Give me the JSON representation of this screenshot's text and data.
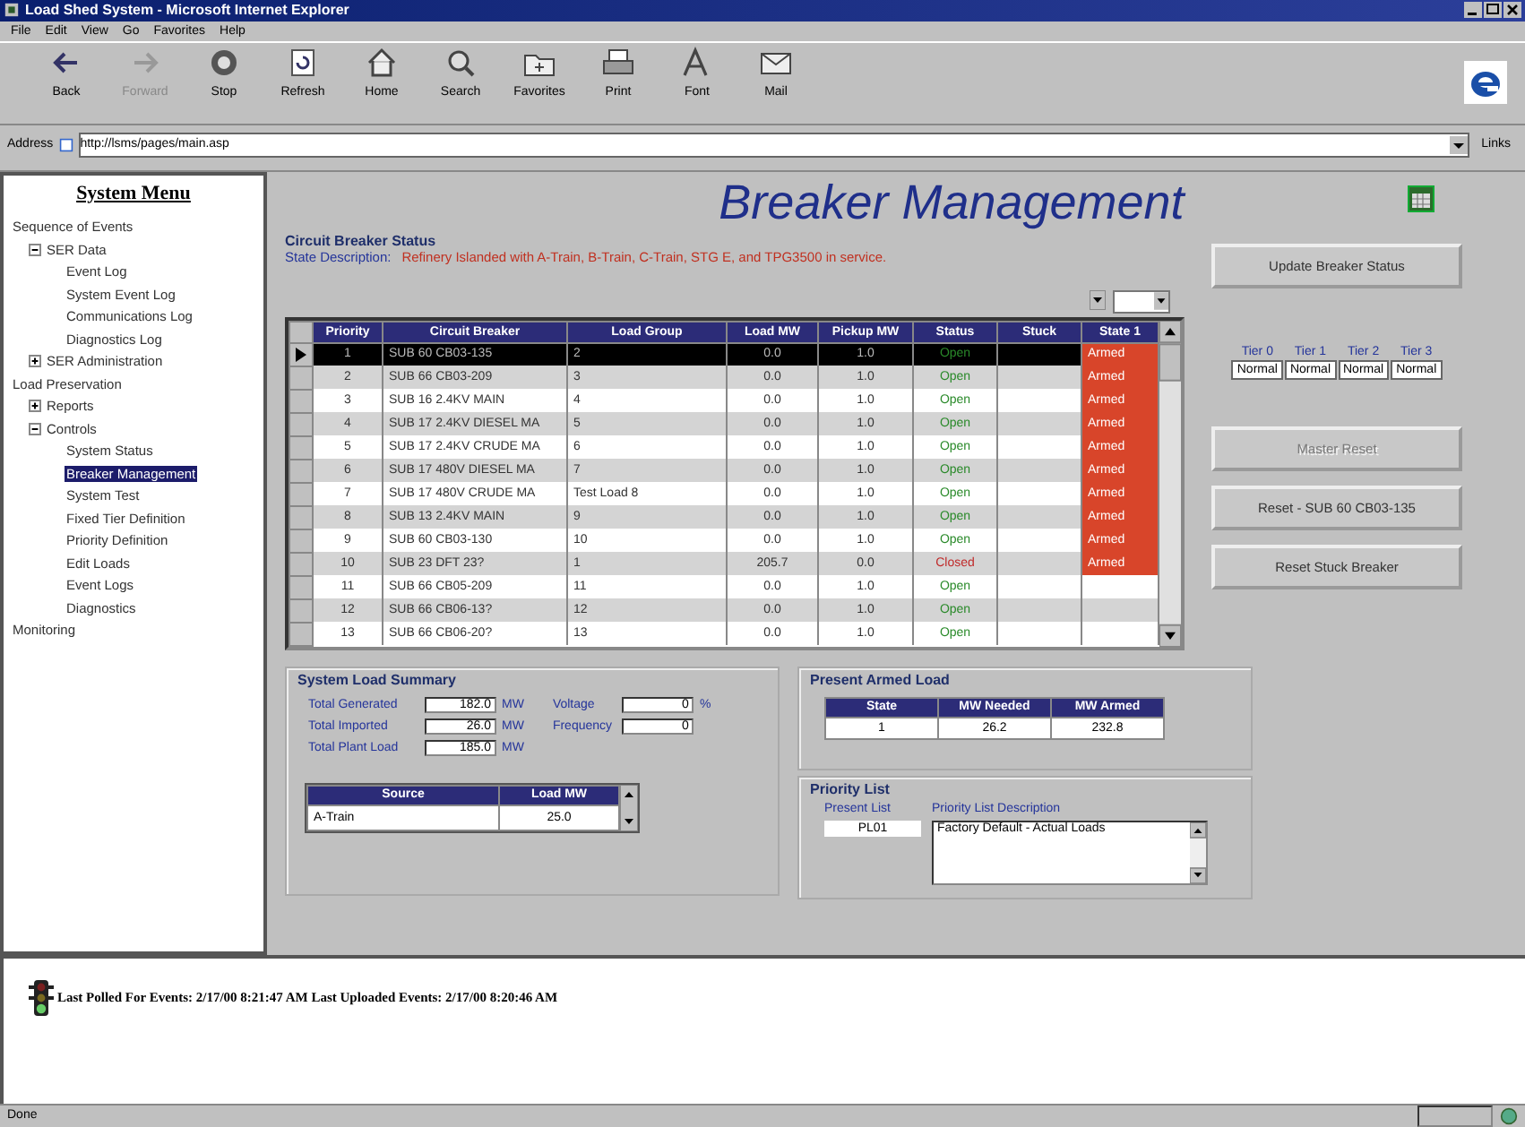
{
  "window": {
    "title": "Load Shed System - Microsoft Internet Explorer"
  },
  "menu": [
    "File",
    "Edit",
    "View",
    "Go",
    "Favorites",
    "Help"
  ],
  "toolbar": [
    {
      "label": "Back",
      "disabled": false
    },
    {
      "label": "Forward",
      "disabled": true
    },
    {
      "label": "Stop",
      "disabled": false
    },
    {
      "label": "Refresh",
      "disabled": false
    },
    {
      "label": "Home",
      "disabled": false
    },
    {
      "label": "Search",
      "disabled": false
    },
    {
      "label": "Favorites",
      "disabled": false
    },
    {
      "label": "Print",
      "disabled": false
    },
    {
      "label": "Font",
      "disabled": false
    },
    {
      "label": "Mail",
      "disabled": false
    }
  ],
  "address": {
    "label": "Address",
    "value": "http://lsms/pages/main.asp",
    "links": "Links"
  },
  "sidebar": {
    "title": "System Menu",
    "tree": [
      {
        "label": "Sequence of Events",
        "selected": false,
        "children": [
          {
            "label": "SER Data",
            "selected": false,
            "expanded": true,
            "children": [
              {
                "label": "Event Log",
                "selected": false
              },
              {
                "label": "System Event Log",
                "selected": false
              },
              {
                "label": "Communications Log",
                "selected": false
              },
              {
                "label": "Diagnostics Log",
                "selected": false
              }
            ]
          },
          {
            "label": "SER Administration",
            "selected": false,
            "expanded": false
          }
        ]
      },
      {
        "label": "Load Preservation",
        "selected": false,
        "children": [
          {
            "label": "Reports",
            "selected": false,
            "expanded": false
          },
          {
            "label": "Controls",
            "selected": false,
            "expanded": true,
            "children": [
              {
                "label": "System Status",
                "selected": false
              },
              {
                "label": "Breaker Management",
                "selected": true
              },
              {
                "label": "System Test",
                "selected": false
              },
              {
                "label": "Fixed Tier Definition",
                "selected": false
              },
              {
                "label": "Priority Definition",
                "selected": false
              },
              {
                "label": "Edit Loads",
                "selected": false
              },
              {
                "label": "Event Logs",
                "selected": false
              },
              {
                "label": "Diagnostics",
                "selected": false
              }
            ]
          }
        ]
      },
      {
        "label": "Monitoring",
        "selected": false
      }
    ]
  },
  "page_title": "Breaker Management",
  "breaker_status": {
    "heading": "Circuit Breaker Status",
    "description_label": "State Description:",
    "description": "Refinery Islanded with A-Train, B-Train, C-Train, STG E, and TPG3500 in service.",
    "table": {
      "columns": [
        "Priority",
        "Circuit Breaker",
        "Load Group",
        "Load MW",
        "Pickup MW",
        "Status",
        "Stuck",
        "State 1"
      ],
      "rows": [
        {
          "selected": true,
          "priority": "1",
          "breaker": "SUB 60 CB03-135",
          "group": "2",
          "load": "0.0",
          "pickup": "1.0",
          "status": "Open",
          "closed": false,
          "stuck": "",
          "armed": true,
          "state1": "Armed"
        },
        {
          "selected": false,
          "priority": "2",
          "breaker": "SUB 66 CB03-209",
          "group": "3",
          "load": "0.0",
          "pickup": "1.0",
          "status": "Open",
          "closed": false,
          "stuck": "",
          "armed": true,
          "state1": "Armed"
        },
        {
          "selected": false,
          "priority": "3",
          "breaker": "SUB 16 2.4KV MAIN",
          "group": "4",
          "load": "0.0",
          "pickup": "1.0",
          "status": "Open",
          "closed": false,
          "stuck": "",
          "armed": true,
          "state1": "Armed"
        },
        {
          "selected": false,
          "priority": "4",
          "breaker": "SUB 17 2.4KV DIESEL MA",
          "group": "5",
          "load": "0.0",
          "pickup": "1.0",
          "status": "Open",
          "closed": false,
          "stuck": "",
          "armed": true,
          "state1": "Armed"
        },
        {
          "selected": false,
          "priority": "5",
          "breaker": "SUB 17 2.4KV CRUDE MA",
          "group": "6",
          "load": "0.0",
          "pickup": "1.0",
          "status": "Open",
          "closed": false,
          "stuck": "",
          "armed": true,
          "state1": "Armed"
        },
        {
          "selected": false,
          "priority": "6",
          "breaker": "SUB 17 480V DIESEL MA",
          "group": "7",
          "load": "0.0",
          "pickup": "1.0",
          "status": "Open",
          "closed": false,
          "stuck": "",
          "armed": true,
          "state1": "Armed"
        },
        {
          "selected": false,
          "priority": "7",
          "breaker": "SUB 17 480V CRUDE MA",
          "group": "Test Load 8",
          "load": "0.0",
          "pickup": "1.0",
          "status": "Open",
          "closed": false,
          "stuck": "",
          "armed": true,
          "state1": "Armed"
        },
        {
          "selected": false,
          "priority": "8",
          "breaker": "SUB 13 2.4KV MAIN",
          "group": "9",
          "load": "0.0",
          "pickup": "1.0",
          "status": "Open",
          "closed": false,
          "stuck": "",
          "armed": true,
          "state1": "Armed"
        },
        {
          "selected": false,
          "priority": "9",
          "breaker": "SUB 60 CB03-130",
          "group": "10",
          "load": "0.0",
          "pickup": "1.0",
          "status": "Open",
          "closed": false,
          "stuck": "",
          "armed": true,
          "state1": "Armed"
        },
        {
          "selected": false,
          "priority": "10",
          "breaker": "SUB 23 DFT 23?",
          "group": "1",
          "load": "205.7",
          "pickup": "0.0",
          "status": "Closed",
          "closed": true,
          "stuck": "",
          "armed": true,
          "state1": "Armed"
        },
        {
          "selected": false,
          "priority": "11",
          "breaker": "SUB 66 CB05-209",
          "group": "11",
          "load": "0.0",
          "pickup": "1.0",
          "status": "Open",
          "closed": false,
          "stuck": "",
          "armed": false,
          "state1": ""
        },
        {
          "selected": false,
          "priority": "12",
          "breaker": "SUB 66 CB06-13?",
          "group": "12",
          "load": "0.0",
          "pickup": "1.0",
          "status": "Open",
          "closed": false,
          "stuck": "",
          "armed": false,
          "state1": ""
        },
        {
          "selected": false,
          "priority": "13",
          "breaker": "SUB 66 CB06-20?",
          "group": "13",
          "load": "0.0",
          "pickup": "1.0",
          "status": "Open",
          "closed": false,
          "stuck": "",
          "armed": false,
          "state1": ""
        }
      ]
    }
  },
  "actions": {
    "update": {
      "label": "Update Breaker Status",
      "disabled": false
    },
    "tiers": [
      {
        "label": "Tier 0",
        "value": "Normal"
      },
      {
        "label": "Tier 1",
        "value": "Normal"
      },
      {
        "label": "Tier 2",
        "value": "Normal"
      },
      {
        "label": "Tier 3",
        "value": "Normal"
      }
    ],
    "buttons": [
      {
        "label": "Master Reset",
        "disabled": true
      },
      {
        "label": "Reset - SUB 60 CB03-135",
        "disabled": false
      },
      {
        "label": "Reset Stuck Breaker",
        "disabled": false
      }
    ]
  },
  "load_summary": {
    "heading": "System Load Summary",
    "fields": [
      {
        "label": "Total Generated",
        "value": "182.0",
        "unit": "MW"
      },
      {
        "label": "Total Imported",
        "value": "26.0",
        "unit": "MW"
      },
      {
        "label": "Total Plant Load",
        "value": "185.0",
        "unit": "MW"
      }
    ],
    "side_fields": [
      {
        "label": "Voltage",
        "value": "0",
        "unit": "%"
      },
      {
        "label": "Frequency",
        "value": "0"
      }
    ],
    "source_table": {
      "columns": [
        "Source",
        "Load MW"
      ],
      "rows": [
        [
          "A-Train",
          "25.0"
        ]
      ]
    }
  },
  "armed_load": {
    "heading": "Present Armed Load",
    "columns": [
      "State",
      "MW Needed",
      "MW Armed"
    ],
    "rows": [
      [
        "1",
        "26.2",
        "232.8"
      ]
    ]
  },
  "priority_list": {
    "heading": "Priority List",
    "present_label": "Present List",
    "present": "PL01",
    "description_label": "Priority List Description",
    "description": "Factory Default - Actual Loads"
  },
  "footer": {
    "text": "Last Polled For Events: 2/17/00 8:21:47 AM Last Uploaded Events: 2/17/00 8:20:46 AM"
  },
  "status_bar": {
    "text": "Done"
  }
}
